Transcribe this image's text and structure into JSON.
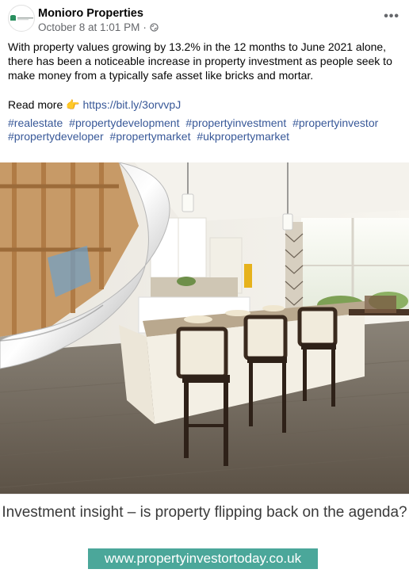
{
  "post": {
    "author": "Monioro Properties",
    "timestamp": "October 8 at 1:01 PM",
    "separator": "·",
    "privacy_icon": "globe-icon",
    "more_label": "•••",
    "body": "With property values growing by 13.2% in the 12 months to June 2021 alone, there has been a noticeable increase in property investment as people seek to make money from a typically safe asset like bricks and mortar.",
    "read_more_label": "Read more",
    "read_more_emoji": "👉",
    "link": "https://bit.ly/3orvvpJ",
    "hashtags": [
      "#realestate",
      "#propertydevelopment",
      "#propertyinvestment",
      "#propertyinvestor",
      "#propertydeveloper",
      "#propertymarket",
      "#ukpropertymarket"
    ]
  },
  "image": {
    "caption": "Investment insight – is property flipping back on the agenda?",
    "url": "www.propertyinvestortoday.co.uk"
  },
  "colors": {
    "link": "#385898",
    "meta": "#65676b",
    "banner": "#4ba79a"
  }
}
